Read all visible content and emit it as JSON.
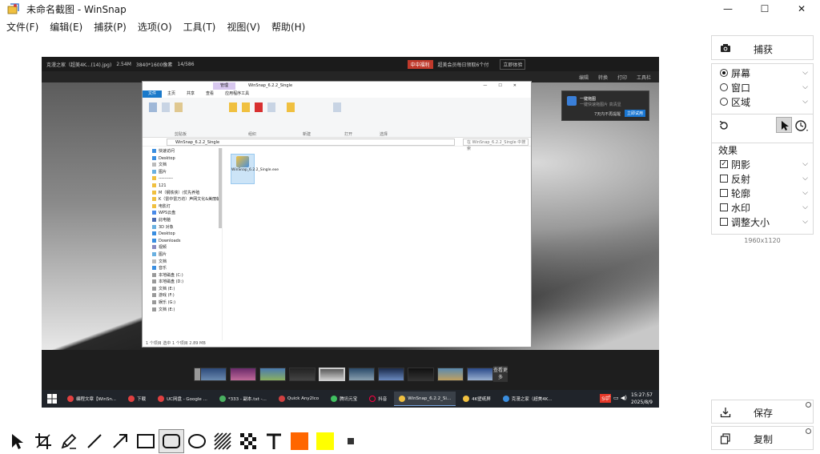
{
  "window": {
    "title": "未命名截图 - WinSnap",
    "controls": [
      "—",
      "☐",
      "✕"
    ]
  },
  "menu": [
    "文件(F)",
    "编辑(E)",
    "捕获(P)",
    "选项(O)",
    "工具(T)",
    "视图(V)",
    "帮助(H)"
  ],
  "screenshot": {
    "viewer_top": {
      "app": "克漫之家（超美4K...(14).jpg)",
      "filesize": "2.54M",
      "resolution": "3840*1600像素",
      "index": "14/586",
      "promo": "中中福利",
      "promo_text": "超美会员每日领取6个付",
      "open_btn": "立即体验"
    },
    "viewer_tools": [
      "编辑",
      "转换",
      "打印",
      "工具栏"
    ],
    "notification": {
      "title": "一键拖图",
      "sub": "一键快速拖图片   高清显",
      "link": "7天内不再提醒",
      "button": "立即试用"
    },
    "explorer": {
      "tab_label": "管理",
      "window_title": "WinSnap_6.2.2_Single",
      "ribbon_tabs": [
        "文件",
        "主页",
        "共享",
        "查看",
        "应用程序工具"
      ],
      "ribbon_groups": [
        "剪贴板",
        "组织",
        "新建",
        "打开",
        "选择"
      ],
      "address": "WinSnap_6.2.2_Single",
      "search_placeholder": "在 WinSnap_6.2.2_Single 中搜索",
      "nav_items": [
        "快速访问",
        "Desktop",
        "文档",
        "图片",
        "----------",
        "121",
        "M（钢铁侠）(优先养殖",
        "K（雷中雷万坊）声网文化&美丽朝",
        "电影灯",
        "WPS云盘",
        "此电脑",
        "3D 对象",
        "Desktop",
        "Downloads",
        "视频",
        "图片",
        "文档",
        "音乐",
        "本地磁盘 (C:)",
        "本地磁盘 (D:)",
        "文档 (E:)",
        "游戏 (F:)",
        "娱乐 (G:)",
        "文档 (E:)"
      ],
      "file_name": "WinSnap_6.2.2_Single.exe",
      "status": "1 个项目    选中 1 个项目  2.89 MB"
    },
    "thumb_more": "查看更多",
    "taskbar": {
      "items": [
        "编程文章【WinSn...",
        "下载",
        "UC网盘 - Google ...",
        "*333 - 副本.txt -...",
        "Quick Any2Ico",
        "腾讯元宝",
        "抖音",
        "WinSnap_6.2.2_Si...",
        "4K壁纸屏",
        "克漫之家（超美4K..."
      ],
      "active_index": 7,
      "ime": "S中",
      "time": "15:27:57",
      "date": "2025/8/9"
    }
  },
  "right_panel": {
    "capture_label": "捕获",
    "modes": [
      "屏幕",
      "窗口",
      "区域"
    ],
    "selected_mode": 0,
    "effects_title": "效果",
    "effects": [
      {
        "label": "阴影",
        "checked": true
      },
      {
        "label": "反射",
        "checked": false
      },
      {
        "label": "轮廓",
        "checked": false
      },
      {
        "label": "水印",
        "checked": false
      },
      {
        "label": "调整大小",
        "checked": false
      }
    ],
    "dimensions": "1960x1120",
    "save_label": "保存",
    "copy_label": "复制"
  },
  "colors": {
    "fill": "#ff6600",
    "stroke": "#ffff00"
  },
  "tools": [
    "select-arrow-icon",
    "crop-icon",
    "pen-icon",
    "line-icon",
    "arrow-icon",
    "rectangle-icon",
    "rounded-rectangle-icon",
    "ellipse-icon",
    "hatch-icon",
    "pixelate-icon",
    "text-icon"
  ]
}
